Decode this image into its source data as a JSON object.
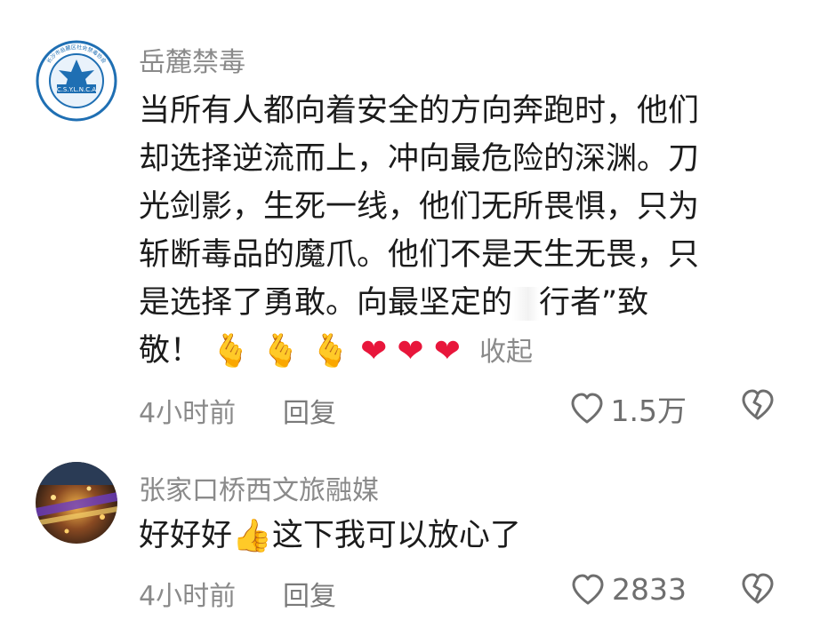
{
  "comments": [
    {
      "username": "岳麓禁毒",
      "avatar_text_top": "长沙市岳麓区社会禁毒协会",
      "avatar_text_center": "C.S.Y.L.N.C.A",
      "text_lines": [
        "当所有人都向着安全的方向奔跑时，他们",
        "却选择逆流而上，冲向最危险的深渊。刀",
        "光剑影，生死一线，他们无所畏惧，只为",
        "斩断毒品的魔爪。他们不是天生无畏，只",
        "是选择了勇敢。向最坚定的",
        "行者”致",
        "敬！"
      ],
      "emojis": [
        "🫰",
        "🫰",
        "🫰",
        "❤",
        "❤",
        "❤"
      ],
      "collapse_label": "收起",
      "time": "4小时前",
      "reply_label": "回复",
      "likes": "1.5万"
    },
    {
      "username": "张家口桥西文旅融媒",
      "text_before_emoji": "好好好",
      "emoji": "👍",
      "text_after_emoji": "这下我可以放心了",
      "time": "4小时前",
      "reply_label": "回复",
      "likes": "2833"
    }
  ],
  "colors": {
    "username": "#8a8a8a",
    "body_text": "#1b1b1b",
    "meta": "#8a8a8a",
    "heart": "#e8163b",
    "avatar_blue": "#1f6fb3"
  },
  "icons": [
    "heart-outline-icon",
    "broken-heart-icon"
  ]
}
